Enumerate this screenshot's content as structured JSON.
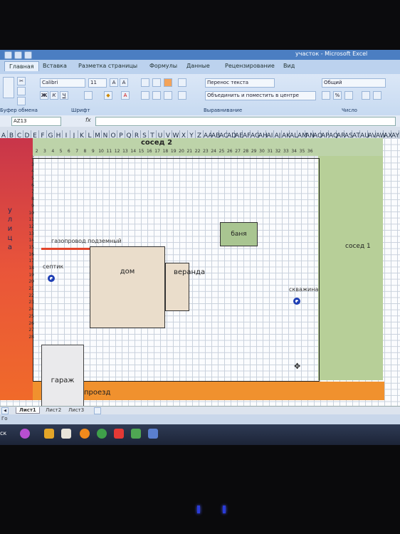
{
  "window": {
    "title": "участок - Microsoft Excel"
  },
  "ribbon": {
    "tabs": [
      "Главная",
      "Вставка",
      "Разметка страницы",
      "Формулы",
      "Данные",
      "Рецензирование",
      "Вид"
    ],
    "font_name": "Calibri",
    "font_size": "11",
    "wrap_text_label": "Перенос текста",
    "merge_label": "Объединить и поместить в центре",
    "number_format": "Общий",
    "group_labels": [
      "Буфер обмена",
      "Шрифт",
      "Выравнивание",
      "Число"
    ]
  },
  "formula_bar": {
    "name_box": "AZ13",
    "fx": "fx",
    "value": ""
  },
  "columns": [
    "A",
    "B",
    "C",
    "D",
    "E",
    "F",
    "G",
    "H",
    "I",
    "J",
    "K",
    "L",
    "M",
    "N",
    "O",
    "P",
    "Q",
    "R",
    "S",
    "T",
    "U",
    "V",
    "W",
    "X",
    "Y",
    "Z",
    "AA",
    "AB",
    "AC",
    "AD",
    "AE",
    "AF",
    "AG",
    "AH",
    "AI",
    "AJ",
    "AK",
    "AL",
    "AM",
    "AN",
    "AO",
    "AP",
    "AQ",
    "AR",
    "AS",
    "AT",
    "AU",
    "AV",
    "AW",
    "AX",
    "AY"
  ],
  "rows": [
    "2",
    "3",
    "4",
    "5",
    "6",
    "7",
    "8",
    "9",
    "10",
    "11",
    "12",
    "13",
    "14",
    "15",
    "16",
    "17",
    "18",
    "19",
    "20",
    "21",
    "22",
    "23",
    "24",
    "25",
    "26",
    "27",
    "28"
  ],
  "plan_numbers": [
    "2",
    "3",
    "4",
    "5",
    "6",
    "7",
    "8",
    "9",
    "10",
    "11",
    "12",
    "13",
    "14",
    "15",
    "16",
    "17",
    "18",
    "19",
    "20",
    "21",
    "22",
    "23",
    "24",
    "25",
    "26",
    "27",
    "28",
    "29",
    "30",
    "31",
    "32",
    "33",
    "34",
    "35",
    "36"
  ],
  "plan": {
    "street": "улица",
    "neighbor_top": "сосед 2",
    "neighbor_right": "сосед 1",
    "driveway": "проезд",
    "bathhouse": "баня",
    "house": "дом",
    "veranda": "веранда",
    "garage": "гараж",
    "gas_pipe": "газопровод подземный",
    "septic": "септик",
    "well": "скважина"
  },
  "sheets": [
    "Лист1",
    "Лист2",
    "Лист3"
  ],
  "status": {
    "text": "Го"
  },
  "taskbar": {
    "start_label": "ск"
  },
  "colors": {
    "street": "#d8443e",
    "driveway": "#f0912e",
    "neighbor": "#b7cf98",
    "well": "#1f3fb4",
    "gas_pipe": "#e2452c"
  }
}
